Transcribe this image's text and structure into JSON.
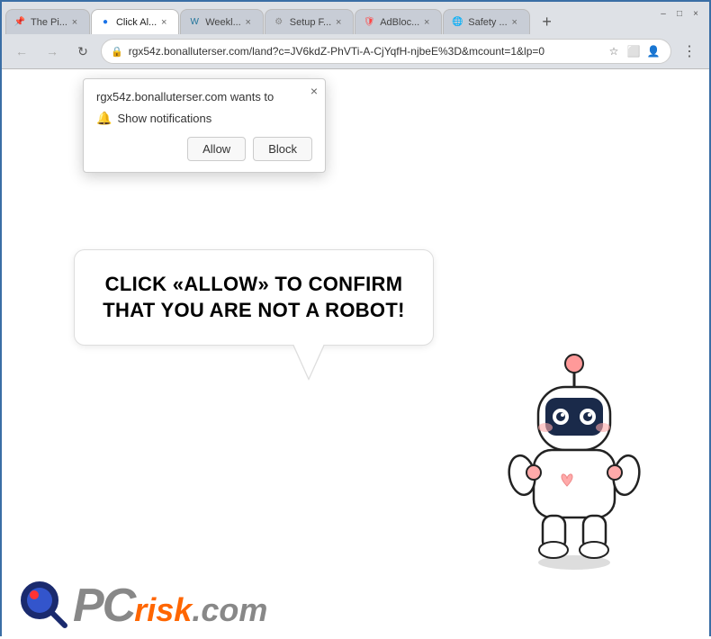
{
  "browser": {
    "tabs": [
      {
        "id": "tab1",
        "label": "The Pi...",
        "favicon": "📌",
        "active": false,
        "favicon_color": "#e44"
      },
      {
        "id": "tab2",
        "label": "Click Al...",
        "favicon": "●",
        "active": true,
        "favicon_color": "#1a73e8"
      },
      {
        "id": "tab3",
        "label": "Weekl...",
        "favicon": "W",
        "active": false,
        "favicon_color": "#21759b"
      },
      {
        "id": "tab4",
        "label": "Setup F...",
        "favicon": "⚙",
        "active": false,
        "favicon_color": "#888"
      },
      {
        "id": "tab5",
        "label": "AdBloc...",
        "favicon": "🛡",
        "active": false,
        "favicon_color": "#f44"
      },
      {
        "id": "tab6",
        "label": "Safety ...",
        "favicon": "🌐",
        "active": false,
        "favicon_color": "#1a73e8"
      }
    ],
    "new_tab_icon": "+",
    "window_controls": [
      "–",
      "□",
      "×"
    ],
    "address_bar": {
      "url": "rgx54z.bonalluterser.com/land?c=JV6kdZ-PhVTi-A-CjYqfH-njbeE%3D&mcount=1&lp=0",
      "lock_icon": "🔒"
    },
    "nav": {
      "back": "←",
      "forward": "→",
      "refresh": "↻"
    }
  },
  "notification_popup": {
    "title": "rgx54z.bonalluterser.com wants to",
    "close_icon": "×",
    "notification_row": {
      "bell_icon": "🔔",
      "text": "Show notifications"
    },
    "buttons": {
      "allow": "Allow",
      "block": "Block"
    }
  },
  "speech_bubble": {
    "text": "CLICK «ALLOW» TO CONFIRM THAT YOU ARE NOT A ROBOT!"
  },
  "pcrisk_logo": {
    "pc_text": "PC",
    "risk_text": "risk",
    "domain": ".com"
  }
}
